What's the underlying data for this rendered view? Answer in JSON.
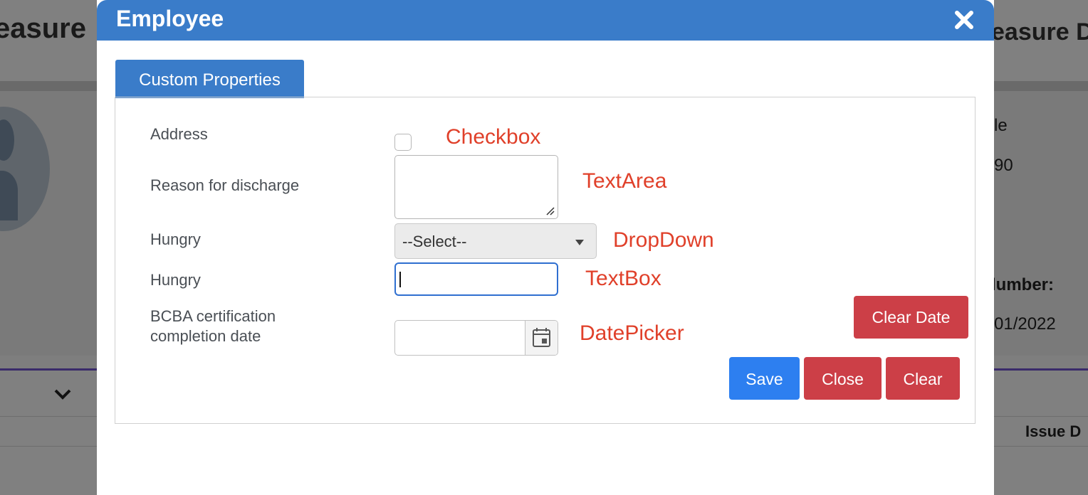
{
  "background": {
    "title_left": "easure",
    "title_right": "easure D",
    "field_1": "le",
    "field_2": "90",
    "field_3_label": "lumber:",
    "field_4": "01/2022",
    "column_header": "Issue D"
  },
  "modal": {
    "title": "Employee",
    "close_icon": "close-icon",
    "tab_label": "Custom Properties",
    "fields": {
      "address_label": "Address",
      "reason_label": "Reason for discharge",
      "hungry_select_label": "Hungry",
      "hungry_text_label": "Hungry",
      "bcba_label_line1": "BCBA certification",
      "bcba_label_line2": "completion date"
    },
    "annotations": {
      "checkbox": "Checkbox",
      "textarea": "TextArea",
      "dropdown": "DropDown",
      "textbox": "TextBox",
      "datepicker": "DatePicker"
    },
    "select_value": "--Select--",
    "checkbox_checked": false,
    "textarea_value": "",
    "textbox_value": "",
    "date_value": "",
    "buttons": {
      "clear_date": "Clear Date",
      "save": "Save",
      "close": "Close",
      "clear": "Clear"
    },
    "colors": {
      "header": "#3a7cc9",
      "save": "#2d7ff0",
      "danger": "#cc3f47",
      "annotation": "#e0402a"
    }
  }
}
